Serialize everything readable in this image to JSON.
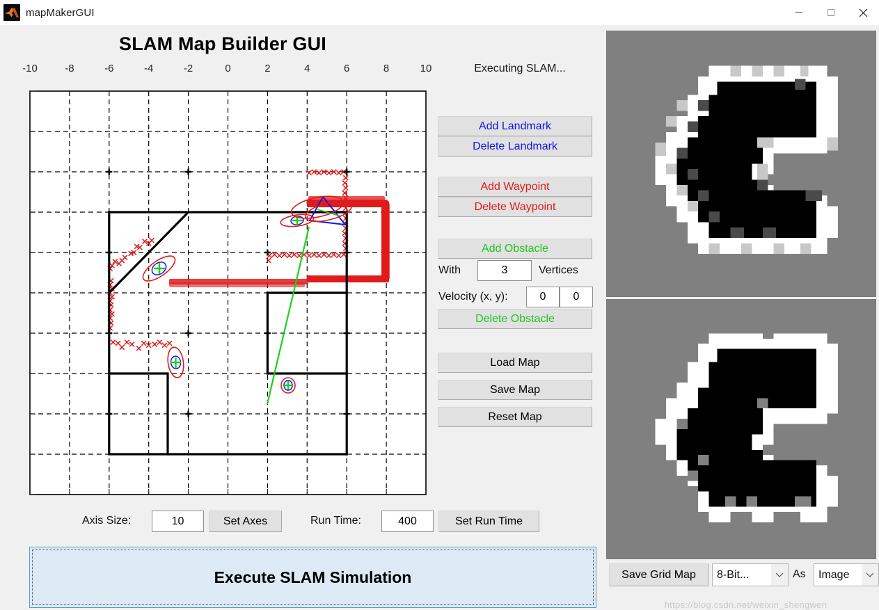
{
  "window": {
    "title": "mapMakerGUI",
    "icon": "matlab-logo-icon",
    "minimize": "—",
    "maximize": "□",
    "close": "✕"
  },
  "header": {
    "title": "SLAM Map Builder GUI"
  },
  "status": {
    "text": "Executing SLAM..."
  },
  "controls": {
    "add_landmark": "Add Landmark",
    "delete_landmark": "Delete Landmark",
    "add_waypoint": "Add Waypoint",
    "delete_waypoint": "Delete Waypoint",
    "add_obstacle": "Add Obstacle",
    "delete_obstacle": "Delete Obstacle",
    "with_label": "With",
    "vertices_value": "3",
    "vertices_label": "Vertices",
    "velocity_label": "Velocity (x, y):",
    "velocity_x": "0",
    "velocity_y": "0",
    "load_map": "Load Map",
    "save_map": "Save Map",
    "reset_map": "Reset Map"
  },
  "colors": {
    "landmark": "#1414e6",
    "waypoint": "#e01b1b",
    "obstacle": "#1fc41f",
    "panel": "#f0f0f0",
    "button": "#e1e1e1",
    "execute_bg": "#ddeaf6",
    "execute_border": "#5a9ccf",
    "grid_unknown": "#808080",
    "grid_occupied": "#000000",
    "grid_free": "#ffffff"
  },
  "axes_row": {
    "axis_size_label": "Axis Size:",
    "axis_size_value": "10",
    "set_axes": "Set Axes",
    "run_time_label": "Run Time:",
    "run_time_value": "400",
    "set_run_time": "Set Run Time"
  },
  "execute": {
    "label": "Execute SLAM Simulation"
  },
  "save_row": {
    "save_grid_map": "Save Grid Map",
    "bitdepth_value": "8-Bit...",
    "as_label": "As",
    "format_value": "Image",
    "chevron": "∨"
  },
  "watermark": "https://blog.csdn.net/weixin_shengwen",
  "chart_data": {
    "type": "scatter",
    "title": "SLAM Map Builder GUI",
    "xlabel": "",
    "ylabel": "",
    "xlim": [
      -10,
      10
    ],
    "ylim": [
      -10,
      10
    ],
    "xticks": [
      -10,
      -8,
      -6,
      -4,
      -2,
      0,
      2,
      4,
      6,
      8,
      10
    ],
    "yticks": [
      -10,
      -8,
      -6,
      -4,
      -2,
      0,
      2,
      4,
      6,
      8,
      10
    ],
    "grid": true,
    "legend": "none",
    "series": [
      {
        "name": "walls",
        "type": "polyline-set",
        "color": "#000000",
        "paths": [
          [
            [
              -6,
              6
            ],
            [
              -2,
              6
            ],
            [
              6,
              6
            ]
          ],
          [
            [
              -6,
              6
            ],
            [
              -6,
              2
            ],
            [
              -6,
              -2
            ],
            [
              -6,
              -6
            ]
          ],
          [
            [
              -6,
              -6
            ],
            [
              -2,
              -6
            ],
            [
              6,
              -6
            ]
          ],
          [
            [
              6,
              6
            ],
            [
              6,
              2
            ],
            [
              6,
              -2
            ],
            [
              6,
              -6
            ]
          ],
          [
            [
              -6,
              2
            ],
            [
              -2,
              6
            ]
          ],
          [
            [
              -6,
              -2
            ],
            [
              -2,
              -2
            ],
            [
              -2,
              -6
            ]
          ],
          [
            [
              2,
              2
            ],
            [
              6,
              2
            ]
          ],
          [
            [
              2,
              2
            ],
            [
              2,
              -2
            ],
            [
              6,
              -2
            ]
          ]
        ]
      },
      {
        "name": "wall-vertices",
        "type": "markers",
        "marker": "plus-black",
        "color": "#000000",
        "points": [
          [
            -6,
            6
          ],
          [
            -2,
            6
          ],
          [
            6,
            6
          ],
          [
            -6,
            2
          ],
          [
            -6,
            -2
          ],
          [
            -2,
            -2
          ],
          [
            -6,
            -6
          ],
          [
            -2,
            -6
          ],
          [
            6,
            -6
          ],
          [
            6,
            2
          ],
          [
            6,
            -2
          ],
          [
            2,
            2
          ],
          [
            2,
            -2
          ]
        ]
      },
      {
        "name": "laser-scan-points",
        "type": "markers",
        "marker": "x",
        "color": "#e01b1b",
        "points": [
          [
            -4.2,
            2.55
          ],
          [
            -4.0,
            2.45
          ],
          [
            -3.85,
            2.6
          ],
          [
            -4.45,
            2.25
          ],
          [
            -4.6,
            2.3
          ],
          [
            -4.75,
            2.0
          ],
          [
            -4.9,
            1.95
          ],
          [
            -5.2,
            1.75
          ],
          [
            -5.35,
            1.6
          ],
          [
            -5.5,
            1.45
          ],
          [
            -5.7,
            1.55
          ],
          [
            -5.85,
            1.35
          ],
          [
            -5.95,
            1.2
          ],
          [
            -5.9,
            0.6
          ],
          [
            -5.95,
            0.4
          ],
          [
            -5.85,
            0.2
          ],
          [
            -5.95,
            0.0
          ],
          [
            -5.85,
            -0.2
          ],
          [
            -5.95,
            -0.4
          ],
          [
            -5.9,
            -0.6
          ],
          [
            -5.95,
            -0.85
          ],
          [
            -5.85,
            -1.05
          ],
          [
            -5.95,
            -1.25
          ],
          [
            -5.9,
            -1.5
          ],
          [
            -5.95,
            -1.75
          ],
          [
            -5.8,
            -2.45
          ],
          [
            -5.55,
            -2.5
          ],
          [
            -5.35,
            -2.7
          ],
          [
            -5.1,
            -2.45
          ],
          [
            -4.85,
            -2.55
          ],
          [
            -4.5,
            -2.75
          ],
          [
            -4.25,
            -2.5
          ],
          [
            -4.0,
            -2.6
          ],
          [
            -3.7,
            -2.55
          ],
          [
            -3.45,
            -2.45
          ],
          [
            -3.2,
            -2.6
          ],
          [
            -2.95,
            -2.5
          ],
          [
            2.1,
            1.85
          ],
          [
            2.35,
            1.9
          ],
          [
            2.6,
            1.85
          ],
          [
            2.85,
            1.9
          ],
          [
            3.1,
            1.85
          ],
          [
            3.35,
            1.9
          ],
          [
            3.6,
            1.85
          ],
          [
            3.85,
            1.9
          ],
          [
            4.1,
            1.85
          ],
          [
            4.35,
            1.9
          ],
          [
            4.6,
            1.85
          ],
          [
            4.85,
            1.9
          ],
          [
            5.1,
            1.85
          ],
          [
            5.35,
            1.9
          ],
          [
            5.6,
            1.85
          ],
          [
            5.85,
            1.9
          ],
          [
            2.05,
            1.6
          ],
          [
            4.1,
            5.95
          ],
          [
            4.35,
            6.0
          ],
          [
            4.6,
            5.95
          ],
          [
            4.85,
            6.0
          ],
          [
            5.1,
            5.95
          ],
          [
            5.35,
            6.0
          ],
          [
            5.6,
            5.95
          ],
          [
            5.85,
            6.0
          ],
          [
            5.95,
            5.7
          ],
          [
            5.9,
            5.45
          ],
          [
            5.95,
            5.2
          ],
          [
            5.9,
            4.95
          ],
          [
            5.95,
            4.7
          ],
          [
            5.9,
            4.45
          ],
          [
            5.95,
            4.2
          ],
          [
            5.9,
            3.95
          ],
          [
            5.95,
            3.7
          ],
          [
            5.9,
            3.45
          ],
          [
            5.95,
            3.2
          ],
          [
            5.9,
            2.95
          ],
          [
            5.95,
            2.7
          ],
          [
            5.9,
            2.45
          ],
          [
            5.95,
            2.2
          ]
        ]
      },
      {
        "name": "landmark-estimates",
        "type": "ellipses",
        "ellipse_color": "#e01b1b",
        "inner_color": "#1414e6",
        "center_marker": "plus-green",
        "center_color": "#19d219",
        "items": [
          {
            "cx": -3.4,
            "cy": 1.2,
            "rx": 0.95,
            "ry": 0.38,
            "angle": -35
          },
          {
            "cx": -2.55,
            "cy": -3.45,
            "rx": 0.35,
            "ry": 0.75,
            "angle": -8
          },
          {
            "cx": 3.05,
            "cy": -4.6,
            "rx": 0.28,
            "ry": 0.33,
            "angle": 0
          },
          {
            "cx": 3.5,
            "cy": 3.6,
            "rx": 0.82,
            "ry": 0.28,
            "angle": -8
          },
          {
            "cx": 4.5,
            "cy": 4.55,
            "rx": 1.35,
            "ry": 0.48,
            "angle": -12
          }
        ]
      },
      {
        "name": "robot-pose",
        "type": "triangle",
        "color": "#1414e6",
        "vertices": [
          [
            4.25,
            5.35
          ],
          [
            5.35,
            4.0
          ],
          [
            3.6,
            4.2
          ]
        ]
      },
      {
        "name": "robot-path",
        "type": "line",
        "color": "#19d219",
        "points": [
          [
            3.0,
            -4.5
          ],
          [
            4.4,
            4.3
          ]
        ]
      }
    ]
  },
  "grid_maps": {
    "top": {
      "name": "8-bit-occupancy-grid",
      "description": "8-bit grayscale occupancy grid map"
    },
    "bottom": {
      "name": "binary-occupancy-grid",
      "description": "binarized occupancy grid map"
    }
  }
}
